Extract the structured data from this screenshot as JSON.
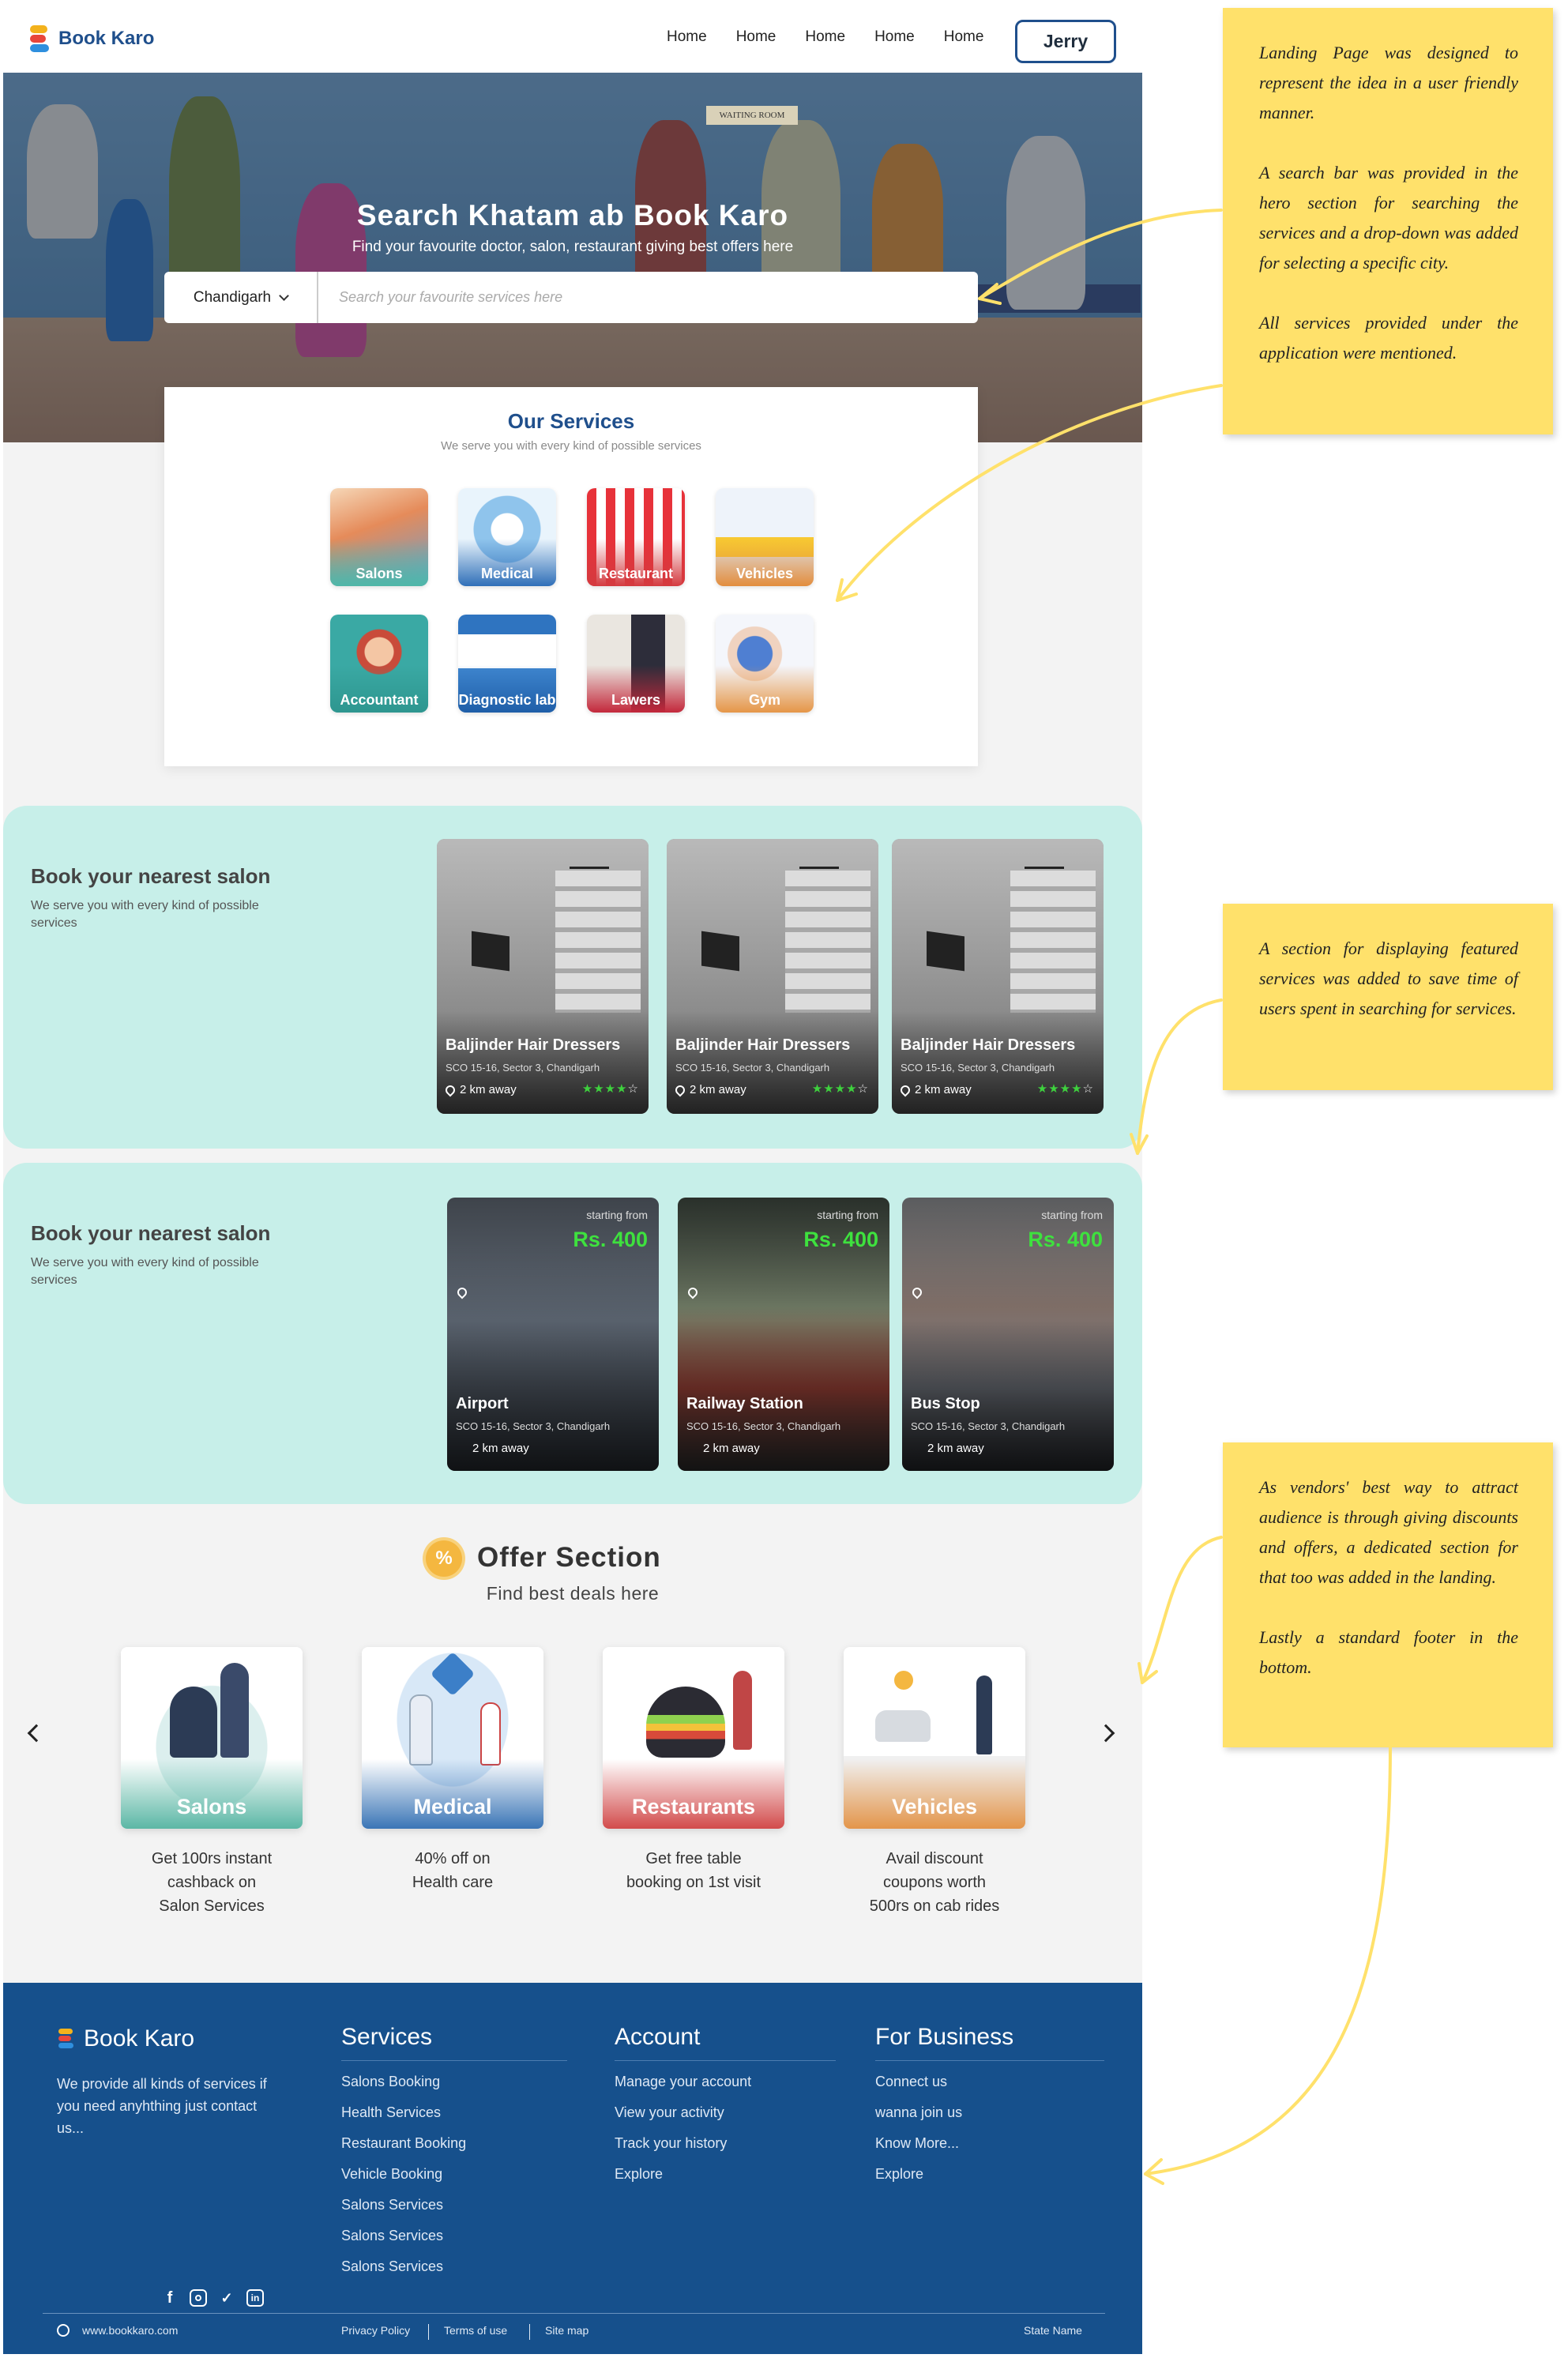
{
  "navbar": {
    "brand": "Book Karo",
    "links": [
      "Home",
      "Home",
      "Home",
      "Home",
      "Home"
    ],
    "user_button": "Jerry"
  },
  "hero": {
    "waiting_sign": "WAITING ROOM",
    "title": "Search Khatam ab Book Karo",
    "subtitle": "Find your favourite doctor, salon, restaurant giving best offers here",
    "city_select": "Chandigarh",
    "search_placeholder": "Search your favourite services here"
  },
  "services": {
    "title": "Our Services",
    "subtitle": "We serve you with every kind of possible services",
    "items": [
      "Salons",
      "Medical",
      "Restaurant",
      "Vehicles",
      "Accountant",
      "Diagnostic lab",
      "Lawers",
      "Gym"
    ]
  },
  "featured_salons": {
    "title": "Book your nearest salon",
    "subtitle": "We serve you with every kind of possible services",
    "cards": [
      {
        "name": "Baljinder Hair Dressers",
        "address": "SCO 15-16, Sector 3, Chandigarh",
        "distance": "2 km away",
        "rating": 4
      },
      {
        "name": "Baljinder Hair Dressers",
        "address": "SCO 15-16, Sector 3, Chandigarh",
        "distance": "2 km away",
        "rating": 4
      },
      {
        "name": "Baljinder Hair Dressers",
        "address": "SCO 15-16, Sector 3, Chandigarh",
        "distance": "2 km away",
        "rating": 4
      }
    ]
  },
  "featured_rides": {
    "title": "Book your nearest salon",
    "subtitle": "We serve you with every kind of possible services",
    "cards": [
      {
        "starting_from": "starting from",
        "price": "Rs. 400",
        "name": "Airport",
        "address": "SCO 15-16, Sector 3, Chandigarh",
        "distance": "2 km away"
      },
      {
        "starting_from": "starting from",
        "price": "Rs. 400",
        "name": "Railway Station",
        "address": "SCO 15-16, Sector 3, Chandigarh",
        "distance": "2 km away"
      },
      {
        "starting_from": "starting from",
        "price": "Rs. 400",
        "name": "Bus Stop",
        "address": "SCO 15-16, Sector 3, Chandigarh",
        "distance": "2 km away"
      }
    ]
  },
  "offers": {
    "badge": "%",
    "title": "Offer Section",
    "subtitle": "Find best deals here",
    "cards": [
      {
        "label": "Salons",
        "line1": "Get 100rs instant",
        "line2": "cashback on",
        "line3": "Salon Services"
      },
      {
        "label": "Medical",
        "line1": "40% off on",
        "line2": "Health care",
        "line3": ""
      },
      {
        "label": "Restaurants",
        "line1": "Get free table",
        "line2": "booking on 1st visit",
        "line3": ""
      },
      {
        "label": "Vehicles",
        "line1": "Avail discount",
        "line2": "coupons worth",
        "line3": "500rs on cab rides"
      }
    ]
  },
  "footer": {
    "brand": "Book Karo",
    "about": "We provide all kinds of services if you need anyhthing just contact us...",
    "columns": [
      {
        "title": "Services",
        "items": [
          "Salons Booking",
          "Health Services",
          "Restaurant Booking",
          "Vehicle Booking",
          "Salons Services",
          "Salons Services",
          "Salons Services"
        ]
      },
      {
        "title": "Account",
        "items": [
          "Manage your account",
          "View your activity",
          "Track your history",
          "Explore"
        ]
      },
      {
        "title": "For Business",
        "items": [
          "Connect us",
          "wanna join us",
          "Know More...",
          "Explore"
        ]
      }
    ],
    "website": "www.bookkaro.com",
    "links": [
      "Privacy Policy",
      "Terms of use",
      "Site map"
    ],
    "state": "State Name"
  },
  "notes": [
    {
      "paragraphs": [
        "Landing Page was designed to represent the idea in a user friendly manner.",
        "A search bar was provided in the hero section for searching the services and a drop-down was added for selecting a specific city.",
        "All services provided under the application were mentioned."
      ]
    },
    {
      "paragraphs": [
        "A section for displaying featured services was added to save time of users spent in searching for services."
      ]
    },
    {
      "paragraphs": [
        "As vendors' best way to attract audience is through giving discounts and offers, a dedicated section for that too was added in the landing.",
        "Lastly a standard footer in the bottom."
      ]
    }
  ],
  "colors": {
    "brand_blue": "#1f4f8c",
    "band_mint": "#c7efe9",
    "footer_blue": "#16508c",
    "note_yellow": "#ffe16b",
    "price_green": "#3ee13e"
  }
}
